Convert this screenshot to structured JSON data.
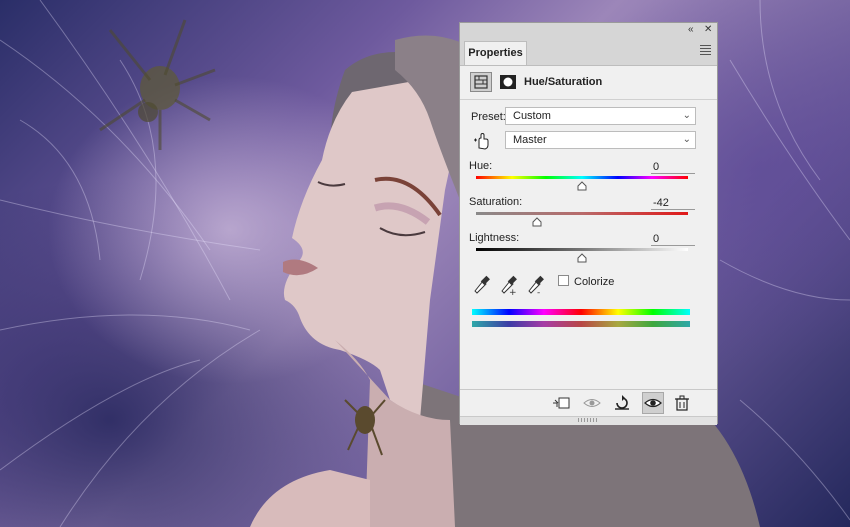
{
  "panel": {
    "tab_label": "Properties",
    "adjustment_title": "Hue/Saturation",
    "preset": {
      "label": "Preset:",
      "value": "Custom"
    },
    "channel": {
      "value": "Master"
    },
    "hue": {
      "label": "Hue:",
      "value": "0",
      "position": 0.5
    },
    "saturation": {
      "label": "Saturation:",
      "value": "-42",
      "position": 0.29
    },
    "lightness": {
      "label": "Lightness:",
      "value": "0",
      "position": 0.5
    },
    "colorize": {
      "label": "Colorize",
      "checked": false
    }
  },
  "icons": {
    "collapse": "double-chevron-left-icon",
    "close": "close-icon",
    "menu": "panel-menu-icon",
    "adjustment": "hue-saturation-adjustment-icon",
    "mask": "layer-mask-icon",
    "targeted_adjust": "hand-targeted-adjustment-icon",
    "eyedropper": "eyedropper-icon",
    "eyedropper_add": "eyedropper-plus-icon",
    "eyedropper_subtract": "eyedropper-minus-icon",
    "clip": "clip-to-layer-icon",
    "view_previous": "view-previous-state-icon",
    "reset": "reset-icon",
    "visibility": "eye-icon",
    "delete": "trash-icon"
  },
  "colors": {
    "panel_bg": "#f0f0f0",
    "header_bg": "#d6d6d6",
    "photo_purple": "#6e5a9e"
  }
}
